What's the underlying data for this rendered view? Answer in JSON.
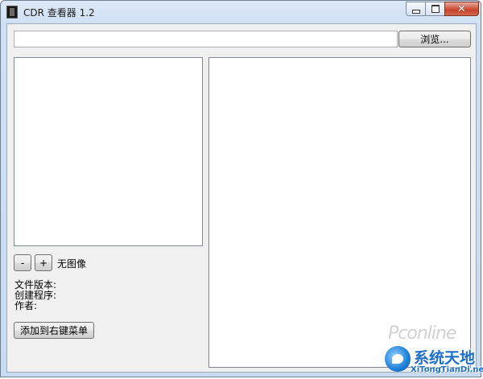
{
  "window": {
    "title": "CDR 查看器 1.2",
    "icons": {
      "app": "app-icon",
      "minimize": "minimize-icon",
      "maximize": "maximize-icon",
      "close": "close-icon"
    }
  },
  "toolbar": {
    "path_value": "",
    "path_placeholder": "",
    "browse_label": "浏览..."
  },
  "preview": {
    "zoom_out_label": "-",
    "zoom_in_label": "+",
    "image_status": "无图像"
  },
  "info": {
    "file_version_label": "文件版本:",
    "creator_label": "创建程序:",
    "author_label": "作者:"
  },
  "actions": {
    "add_context_menu_label": "添加到右键菜单"
  },
  "watermark": {
    "site": "Pconline",
    "brand_cn": "系统天地",
    "brand_en": "XiTongTianDi.net"
  },
  "colors": {
    "title_bar": "#dce8f6",
    "client_bg": "#f0f0f0",
    "close_button": "#c8432b",
    "watermark_blue": "#1e6fc8"
  }
}
